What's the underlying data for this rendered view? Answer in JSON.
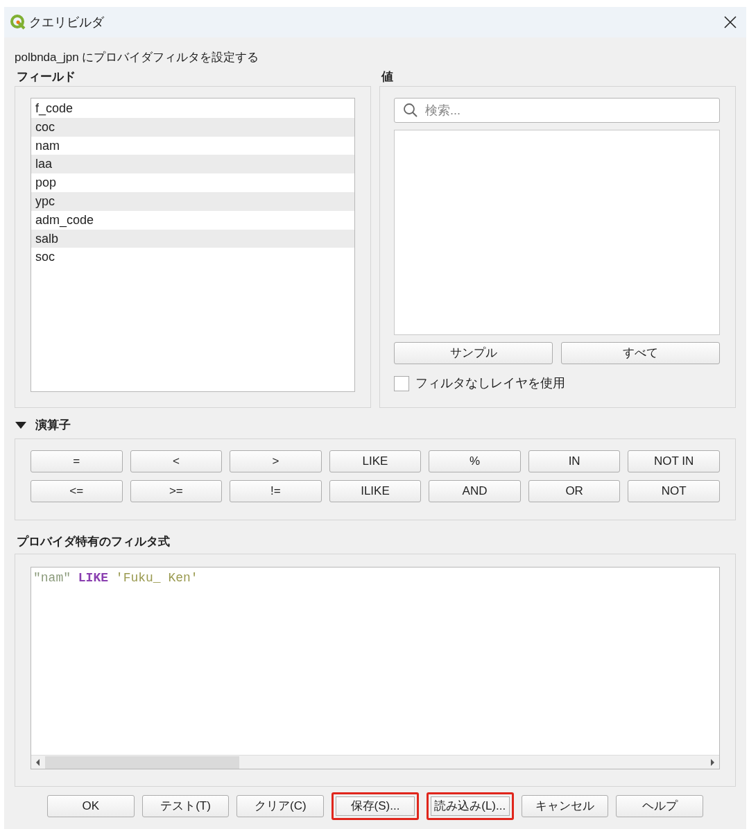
{
  "window": {
    "title": "クエリビルダ"
  },
  "subtitle": "polbnda_jpn にプロバイダフィルタを設定する",
  "fields": {
    "label": "フィールド",
    "items": [
      {
        "name": "f_code",
        "shaded": false
      },
      {
        "name": "coc",
        "shaded": true
      },
      {
        "name": "nam",
        "shaded": false
      },
      {
        "name": "laa",
        "shaded": true
      },
      {
        "name": "pop",
        "shaded": false
      },
      {
        "name": "ypc",
        "shaded": true
      },
      {
        "name": "adm_code",
        "shaded": false
      },
      {
        "name": "salb",
        "shaded": true
      },
      {
        "name": "soc",
        "shaded": false
      }
    ]
  },
  "values": {
    "label": "値",
    "search": {
      "placeholder": "検索..."
    },
    "buttons": [
      "サンプル",
      "すべて"
    ],
    "checkbox": {
      "label": "フィルタなしレイヤを使用",
      "checked": false
    }
  },
  "operators": {
    "label": "演算子",
    "expanded": true,
    "rows": [
      [
        "=",
        "<",
        ">",
        "LIKE",
        "%",
        "IN",
        "NOT IN"
      ],
      [
        "<=",
        ">=",
        "!=",
        "ILIKE",
        "AND",
        "OR",
        "NOT"
      ]
    ]
  },
  "expression": {
    "label": "プロバイダ特有のフィルタ式",
    "tokens": [
      {
        "kind": "field",
        "text": "\"nam\""
      },
      {
        "kind": "keyword",
        "text": "LIKE"
      },
      {
        "kind": "string",
        "text": "'Fuku_ Ken'"
      }
    ]
  },
  "buttons": [
    {
      "label": "OK",
      "highlighted": false
    },
    {
      "label": "テスト(T)",
      "highlighted": false
    },
    {
      "label": "クリア(C)",
      "highlighted": false
    },
    {
      "label": "保存(S)...",
      "highlighted": true
    },
    {
      "label": "読み込み(L)...",
      "highlighted": true
    },
    {
      "label": "キャンセル",
      "highlighted": false
    },
    {
      "label": "ヘルプ",
      "highlighted": false
    }
  ]
}
